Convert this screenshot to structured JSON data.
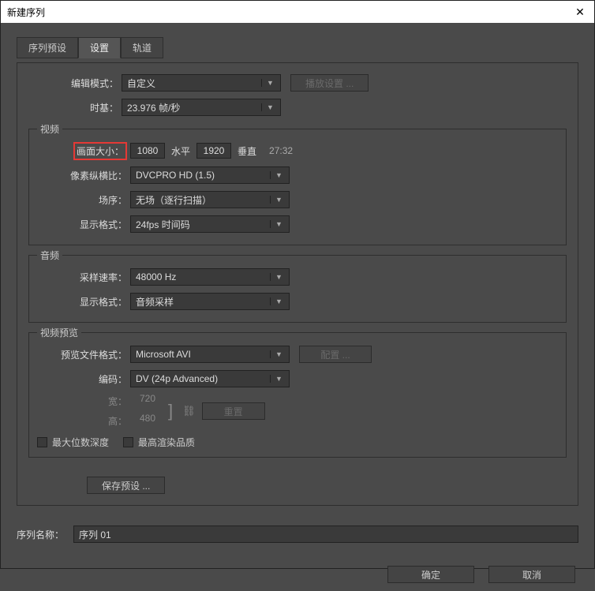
{
  "title": "新建序列",
  "tabs": [
    "序列预设",
    "设置",
    "轨道"
  ],
  "editMode": {
    "label": "编辑模式：",
    "value": "自定义",
    "sideBtn": "播放设置 ..."
  },
  "timebase": {
    "label": "时基：",
    "value": "23.976 帧/秒"
  },
  "video": {
    "title": "视频",
    "frameSize": {
      "label": "画面大小：",
      "w": "1080",
      "wLabel": "水平",
      "h": "1920",
      "hLabel": "垂直",
      "ratio": "27:32"
    },
    "pixelAspect": {
      "label": "像素纵横比：",
      "value": "DVCPRO HD (1.5)"
    },
    "fields": {
      "label": "场序：",
      "value": "无场（逐行扫描）"
    },
    "displayFmt": {
      "label": "显示格式：",
      "value": "24fps 时间码"
    }
  },
  "audio": {
    "title": "音频",
    "sampleRate": {
      "label": "采样速率：",
      "value": "48000 Hz"
    },
    "displayFmt": {
      "label": "显示格式：",
      "value": "音频采样"
    }
  },
  "preview": {
    "title": "视频预览",
    "fileFmt": {
      "label": "预览文件格式：",
      "value": "Microsoft AVI",
      "sideBtn": "配置 ..."
    },
    "codec": {
      "label": "编码：",
      "value": "DV (24p Advanced)"
    },
    "width": {
      "label": "宽：",
      "value": "720"
    },
    "height": {
      "label": "高：",
      "value": "480"
    },
    "resetBtn": "重置",
    "maxBitDepth": "最大位数深度",
    "maxRenderQuality": "最高渲染品质"
  },
  "savePreset": "保存预设 ...",
  "seqName": {
    "label": "序列名称：",
    "value": "序列 01"
  },
  "ok": "确定",
  "cancel": "取消"
}
